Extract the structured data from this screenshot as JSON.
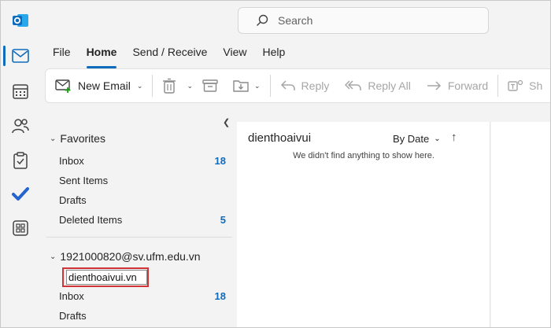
{
  "rail": {
    "items": [
      {
        "name": "mail-icon"
      },
      {
        "name": "calendar-icon"
      },
      {
        "name": "people-icon"
      },
      {
        "name": "tasks-icon"
      },
      {
        "name": "todo-icon"
      },
      {
        "name": "apps-icon"
      }
    ]
  },
  "search": {
    "placeholder": "Search"
  },
  "menu": {
    "tabs": [
      "File",
      "Home",
      "Send / Receive",
      "View",
      "Help"
    ],
    "active": "Home"
  },
  "ribbon": {
    "new_email": "New Email",
    "reply": "Reply",
    "reply_all": "Reply All",
    "forward": "Forward",
    "share_partial": "Sh"
  },
  "folders": {
    "favorites": {
      "label": "Favorites",
      "items": [
        {
          "label": "Inbox",
          "count": "18"
        },
        {
          "label": "Sent Items",
          "count": ""
        },
        {
          "label": "Drafts",
          "count": ""
        },
        {
          "label": "Deleted Items",
          "count": "5"
        }
      ]
    },
    "account": {
      "label": "1921000820@sv.ufm.edu.vn",
      "rename_value": "dienthoaivui.vn",
      "items": [
        {
          "label": "Inbox",
          "count": "18"
        },
        {
          "label": "Drafts",
          "count": ""
        }
      ]
    }
  },
  "message_list": {
    "folder_title": "dienthoaivui",
    "sort_label": "By Date",
    "empty_text": "We didn't find anything to show here."
  },
  "colors": {
    "accent": "#0f6cbd",
    "rename_border": "#d13438"
  }
}
